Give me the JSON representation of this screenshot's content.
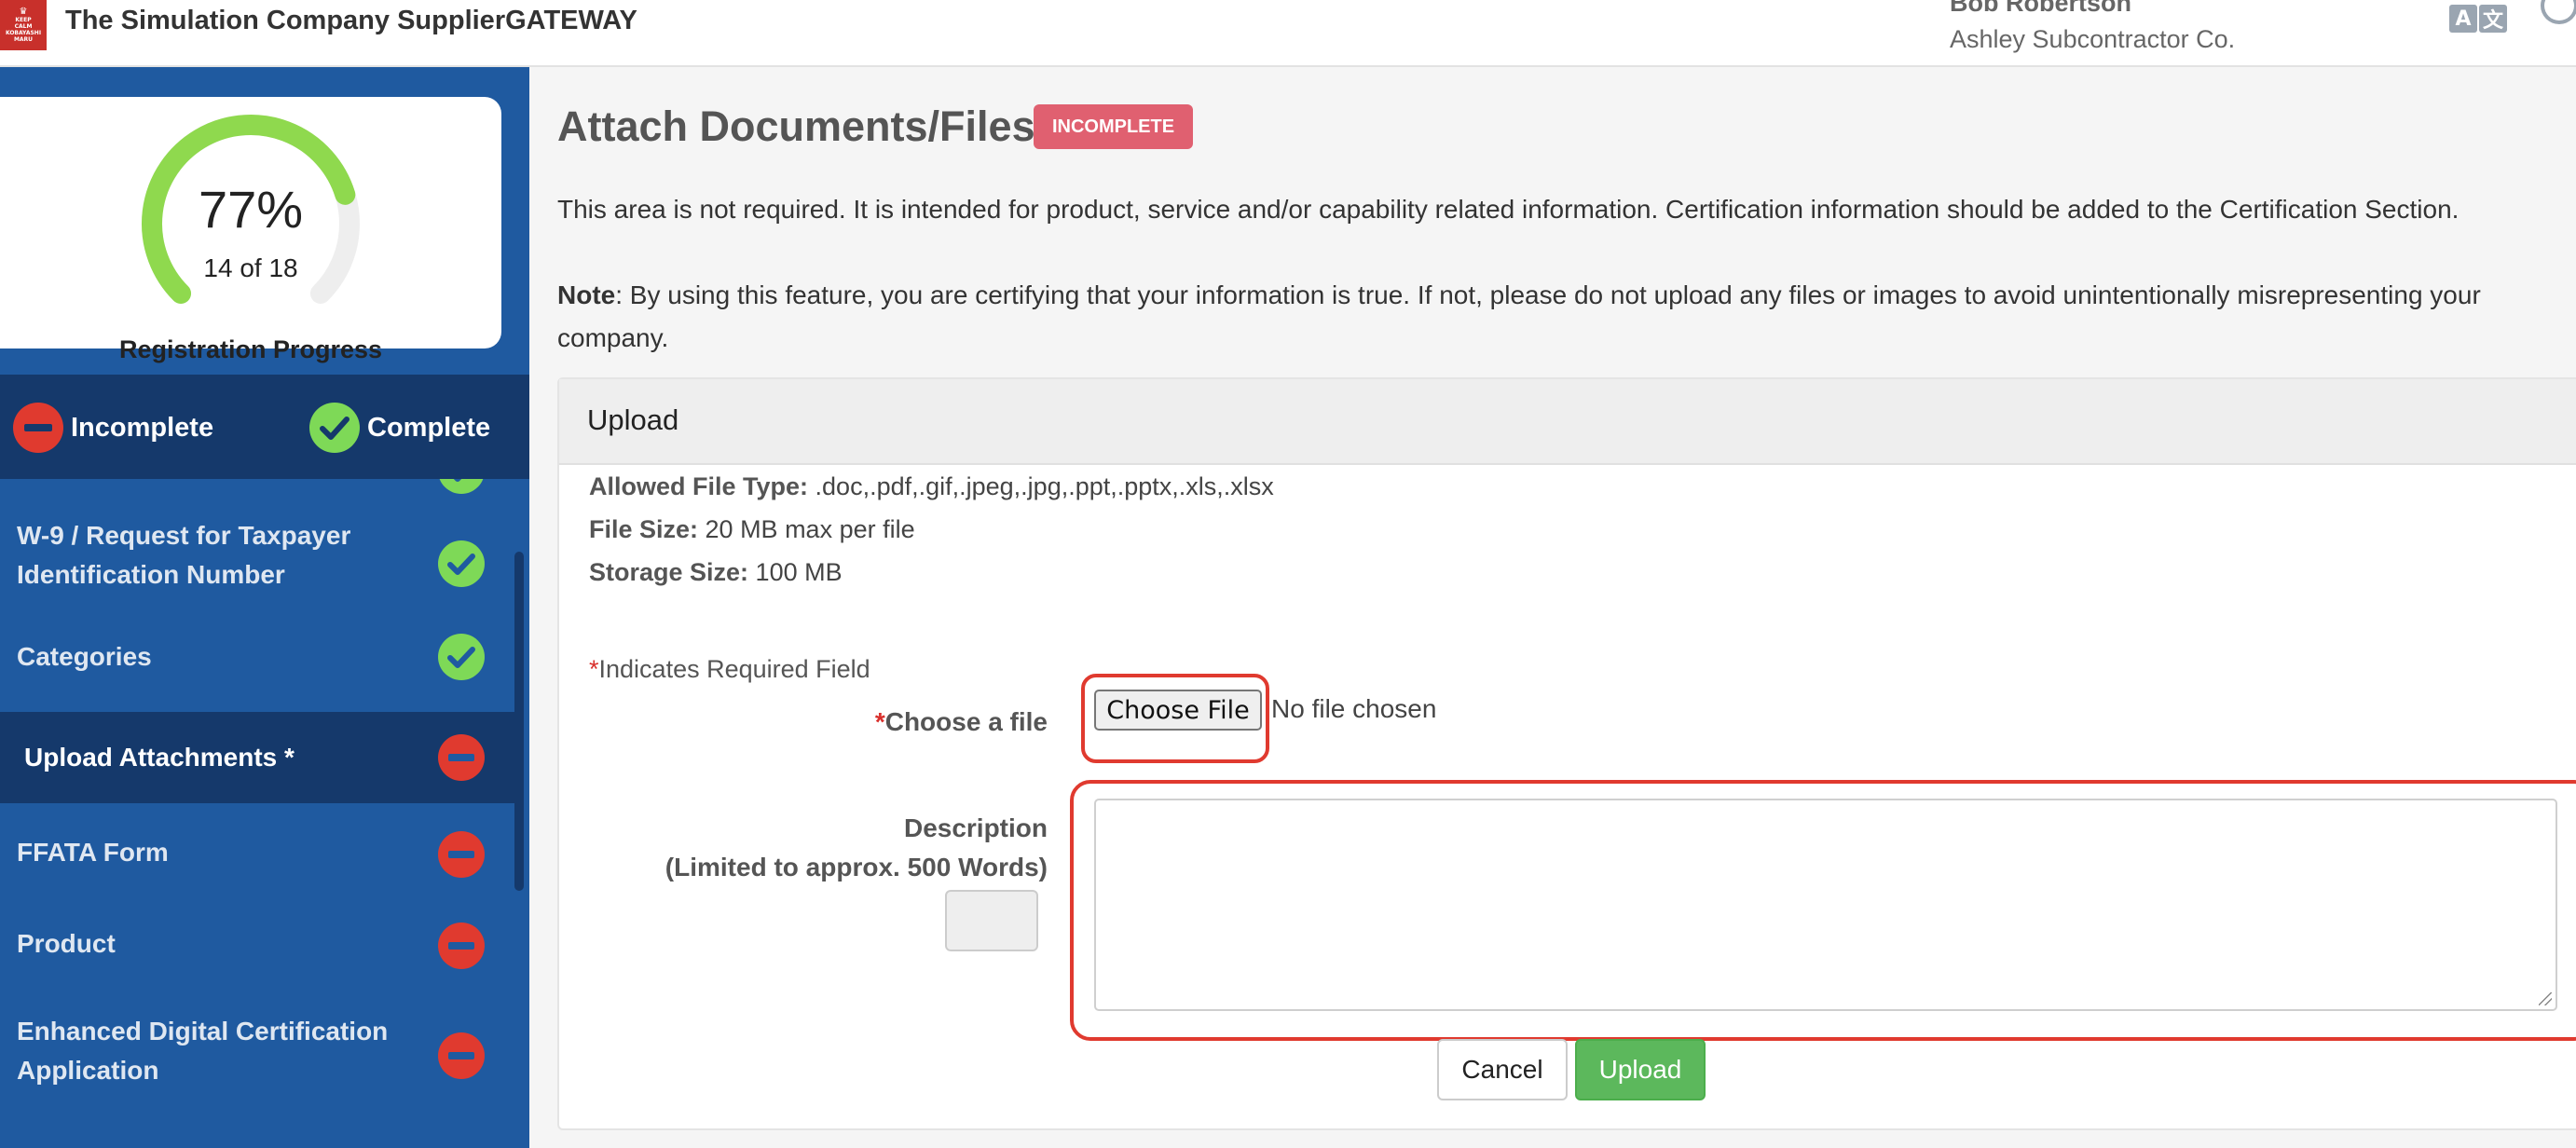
{
  "header": {
    "logo_lines": [
      "KEEP",
      "CALM",
      "KOBAYASHI",
      "MARU"
    ],
    "app_title": "The Simulation Company SupplierGATEWAY",
    "user_name": "Bob Robertson",
    "user_company": "Ashley Subcontractor Co.",
    "lang_glyph_a": "A",
    "lang_glyph_b": "文"
  },
  "progress": {
    "percent_label": "77%",
    "percent_value": 77,
    "count_label": "14 of 18",
    "title": "Registration Progress"
  },
  "legend": {
    "incomplete": "Incomplete",
    "complete": "Complete"
  },
  "nav": {
    "items": [
      {
        "label": "",
        "status": "complete"
      },
      {
        "label": "W-9 / Request for Taxpayer Identification Number",
        "line1": "W-9 / Request for Taxpayer",
        "line2": "Identification Number",
        "status": "complete"
      },
      {
        "label": "Categories",
        "status": "complete"
      },
      {
        "label": "Upload Attachments *",
        "status": "incomplete",
        "active": true
      },
      {
        "label": "FFATA Form",
        "status": "incomplete"
      },
      {
        "label": "Product",
        "status": "incomplete"
      },
      {
        "label": "Enhanced Digital Certification Application",
        "line1": "Enhanced Digital Certification",
        "line2": "Application",
        "status": "incomplete"
      }
    ]
  },
  "main": {
    "title": "Attach Documents/Files",
    "status_badge": "INCOMPLETE",
    "intro": "This area is not required. It is intended for product, service and/or capability related information. Certification information should be added to the Certification Section.",
    "note_label": "Note",
    "note_text": ": By using this feature, you are certifying that your information is true. If not, please do not upload any files or images to avoid unintentionally misrepresenting your company.",
    "panel": {
      "title": "Upload",
      "allowed_label": "Allowed File Type:",
      "allowed_value": " .doc,.pdf,.gif,.jpeg,.jpg,.ppt,.pptx,.xls,.xlsx",
      "size_label": "File Size:",
      "size_value": " 20 MB max per file",
      "storage_label": "Storage Size:",
      "storage_value": " 100 MB",
      "required_star": "*",
      "required_note": "Indicates Required Field",
      "choose_label": "Choose a file",
      "choose_button": "Choose File",
      "no_file": "No file chosen",
      "desc_label": "Description",
      "desc_limit": "(Limited to approx. 500 Words)",
      "desc_value": "",
      "cancel": "Cancel",
      "upload": "Upload"
    }
  },
  "colors": {
    "sidebar": "#1f5aa0",
    "sidebar_dark": "#15396b",
    "complete": "#7ed957",
    "incomplete": "#e03a2f",
    "badge": "#e06070",
    "upload_button": "#5cb85c"
  }
}
